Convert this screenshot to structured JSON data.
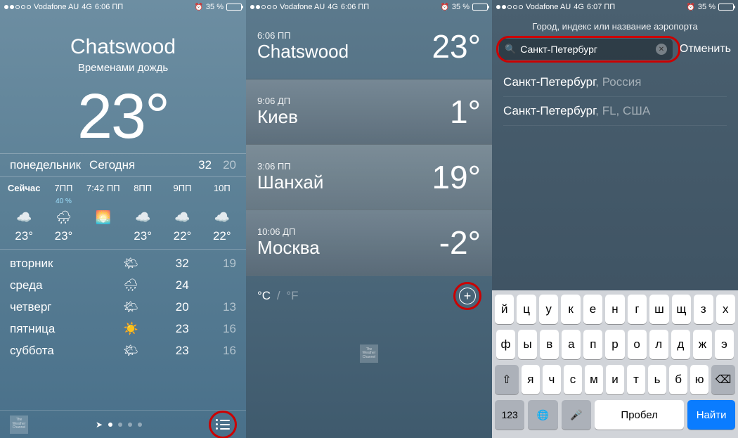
{
  "status": {
    "carrier": "Vodafone AU",
    "network": "4G",
    "time1": "6:06 ПП",
    "time2": "6:06 ПП",
    "time3": "6:07 ПП",
    "battery_pct": "35 %",
    "alarm_icon": "⏰"
  },
  "screen1": {
    "city": "Chatswood",
    "condition": "Временами дождь",
    "temp": "23°",
    "today": {
      "day": "понедельник",
      "label": "Сегодня",
      "hi": "32",
      "lo": "20"
    },
    "hourly": [
      {
        "time": "Сейчас",
        "precip": "",
        "icon": "☁️",
        "temp": "23°",
        "now": true
      },
      {
        "time": "7ПП",
        "precip": "40 %",
        "icon": "🌧",
        "temp": "23°"
      },
      {
        "time": "7:42 ПП",
        "precip": "",
        "icon": "🌅",
        "temp": ""
      },
      {
        "time": "8ПП",
        "precip": "",
        "icon": "☁️",
        "temp": "23°"
      },
      {
        "time": "9ПП",
        "precip": "",
        "icon": "☁️",
        "temp": "22°"
      },
      {
        "time": "10П",
        "precip": "",
        "icon": "☁️",
        "temp": "22°"
      }
    ],
    "daily": [
      {
        "day": "вторник",
        "icon": "🌤",
        "hi": "32",
        "lo": "19"
      },
      {
        "day": "среда",
        "icon": "🌧",
        "hi": "24",
        "lo": ""
      },
      {
        "day": "четверг",
        "icon": "🌤",
        "hi": "20",
        "lo": "13"
      },
      {
        "day": "пятница",
        "icon": "☀️",
        "hi": "23",
        "lo": "16"
      },
      {
        "day": "суббота",
        "icon": "🌤",
        "hi": "23",
        "lo": "16"
      }
    ],
    "twc_label": "The Weather Channel"
  },
  "screen2": {
    "cities": [
      {
        "time": "6:06 ПП",
        "name": "Chatswood",
        "temp": "23°"
      },
      {
        "time": "9:06 ДП",
        "name": "Киев",
        "temp": "1°"
      },
      {
        "time": "3:06 ПП",
        "name": "Шанхай",
        "temp": "19°"
      },
      {
        "time": "10:06 ДП",
        "name": "Москва",
        "temp": "-2°"
      }
    ],
    "unit_c": "°C",
    "unit_sep": "/",
    "unit_f": "°F",
    "plus": "+",
    "twc_label": "The Weather Channel"
  },
  "screen3": {
    "prompt": "Город, индекс или название аэропорта",
    "search_value": "Санкт-Петербург",
    "cancel": "Отменить",
    "results": [
      {
        "main": "Санкт-Петербург",
        "sec": ", Россия"
      },
      {
        "main": "Санкт-Петербург",
        "sec": ", FL, США"
      }
    ],
    "keyboard": {
      "row1": [
        "й",
        "ц",
        "у",
        "к",
        "е",
        "н",
        "г",
        "ш",
        "щ",
        "з",
        "х"
      ],
      "row2": [
        "ф",
        "ы",
        "в",
        "а",
        "п",
        "р",
        "о",
        "л",
        "д",
        "ж",
        "э"
      ],
      "row3": [
        "я",
        "ч",
        "с",
        "м",
        "и",
        "т",
        "ь",
        "б",
        "ю"
      ],
      "shift": "⇧",
      "backspace": "⌫",
      "num": "123",
      "globe": "🌐",
      "mic": "🎤",
      "space": "Пробел",
      "find": "Найти"
    }
  }
}
